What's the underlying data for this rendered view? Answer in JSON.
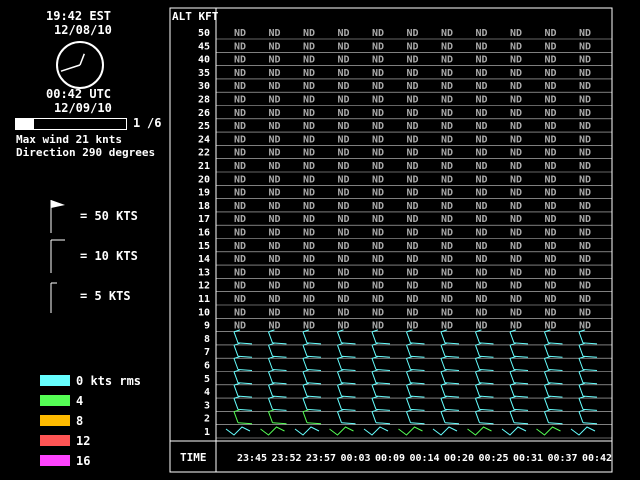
{
  "time_panel": {
    "local_time": "19:42 EST",
    "local_date": "12/08/10",
    "utc_time": "00:42 UTC",
    "utc_date": "12/09/10",
    "clock": {
      "hour_hand": 12.7,
      "minute_hand": 42
    }
  },
  "page": {
    "current": "1",
    "total": "/6",
    "progress": 0.1667
  },
  "wind_summary": {
    "max_wind": "Max wind 21 knts",
    "direction": "Direction 290 degrees"
  },
  "barb_legend": [
    {
      "label": "= 50 KTS",
      "icon": "flag-barb-icon"
    },
    {
      "label": "= 10 KTS",
      "icon": "full-barb-icon"
    },
    {
      "label": "=  5 KTS",
      "icon": "half-barb-icon"
    }
  ],
  "rms_legend": [
    {
      "label": "0 kts rms",
      "color": "#66ffff"
    },
    {
      "label": "4",
      "color": "#55ff55"
    },
    {
      "label": "8",
      "color": "#ffbb00"
    },
    {
      "label": "12",
      "color": "#ff5555"
    },
    {
      "label": "16",
      "color": "#ff44ff"
    }
  ],
  "chart_data": {
    "type": "table",
    "y_header": "ALT KFT",
    "x_header": "TIME",
    "altitudes": [
      "50",
      "45",
      "40",
      "35",
      "30",
      "28",
      "26",
      "25",
      "24",
      "22",
      "21",
      "20",
      "19",
      "18",
      "17",
      "16",
      "15",
      "14",
      "13",
      "12",
      "11",
      "10",
      "9",
      "8",
      "7",
      "6",
      "5",
      "4",
      "3",
      "2",
      "1"
    ],
    "times": [
      "23:45",
      "23:52",
      "23:57",
      "00:03",
      "00:09",
      "00:14",
      "00:20",
      "00:25",
      "00:31",
      "00:37",
      "00:42"
    ],
    "no_data_label": "ND",
    "no_data_altitudes": [
      "50",
      "45",
      "40",
      "35",
      "30",
      "28",
      "26",
      "25",
      "24",
      "22",
      "21",
      "20",
      "19",
      "18",
      "17",
      "16",
      "15",
      "14",
      "13",
      "12",
      "11",
      "10",
      "9"
    ],
    "barb_altitudes": [
      "8",
      "7",
      "6",
      "5",
      "4",
      "3",
      "2",
      "1"
    ]
  }
}
